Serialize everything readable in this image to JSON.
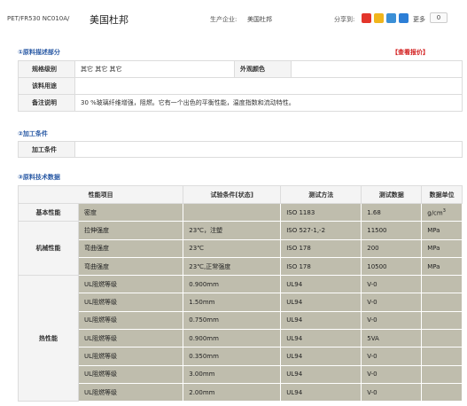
{
  "header": {
    "code": "PET/FR530 NC010A/",
    "title": "美国杜邦",
    "manufacturer_label": "生产企业:",
    "manufacturer_value": "美国杜邦",
    "share_label": "分享到:",
    "share_icons": [
      {
        "name": "weibo-icon",
        "color": "#e3352b"
      },
      {
        "name": "qzone-icon",
        "color": "#f0b51c"
      },
      {
        "name": "tqq-icon",
        "color": "#3b8fd6"
      },
      {
        "name": "renren-icon",
        "color": "#2c7ed6"
      }
    ],
    "more_label": "更多",
    "share_count": "0"
  },
  "section1": {
    "title": "①原料描述部分",
    "quote_link": "【查看报价】",
    "rows": {
      "spec_label": "规格级别",
      "spec_value": "其它 其它 其它",
      "color_label": "外观颜色",
      "color_value": "",
      "usage_label": "该料用途",
      "usage_value": "",
      "note_label": "备注说明",
      "note_value": "30 %玻璃纤维增强，阻燃。它有一个出色的平衡性能，温度指数和流动特性。"
    }
  },
  "section2": {
    "title": "②加工条件",
    "label": "加工条件",
    "value": ""
  },
  "section3": {
    "title": "③原料技术数据",
    "headers": [
      "性能项目",
      "试验条件[状态]",
      "测试方法",
      "测试数据",
      "数据单位"
    ],
    "groups": [
      {
        "name": "基本性能",
        "rows": [
          {
            "item": "密度",
            "cond": "",
            "method": "ISO 1183",
            "value": "1.68",
            "unit": "g/cm"
          }
        ]
      },
      {
        "name": "机械性能",
        "rows": [
          {
            "item": "拉伸强度",
            "cond": "23℃，注塑",
            "method": "ISO 527-1,-2",
            "value": "11500",
            "unit": "MPa"
          },
          {
            "item": "弯曲强度",
            "cond": "23℃",
            "method": "ISO 178",
            "value": "200",
            "unit": "MPa"
          },
          {
            "item": "弯曲强度",
            "cond": "23℃,正常强度",
            "method": "ISO 178",
            "value": "10500",
            "unit": "MPa"
          }
        ]
      },
      {
        "name": "热性能",
        "rows": [
          {
            "item": "UL阻燃等级",
            "cond": "0.900mm",
            "method": "UL94",
            "value": "V-0",
            "unit": ""
          },
          {
            "item": "UL阻燃等级",
            "cond": "1.50mm",
            "method": "UL94",
            "value": "V-0",
            "unit": ""
          },
          {
            "item": "UL阻燃等级",
            "cond": "0.750mm",
            "method": "UL94",
            "value": "V-0",
            "unit": ""
          },
          {
            "item": "UL阻燃等级",
            "cond": "0.900mm",
            "method": "UL94",
            "value": "5VA",
            "unit": ""
          },
          {
            "item": "UL阻燃等级",
            "cond": "0.350mm",
            "method": "UL94",
            "value": "V-0",
            "unit": ""
          },
          {
            "item": "UL阻燃等级",
            "cond": "3.00mm",
            "method": "UL94",
            "value": "V-0",
            "unit": ""
          },
          {
            "item": "UL阻燃等级",
            "cond": "2.00mm",
            "method": "UL94",
            "value": "V-0",
            "unit": ""
          }
        ]
      }
    ]
  }
}
